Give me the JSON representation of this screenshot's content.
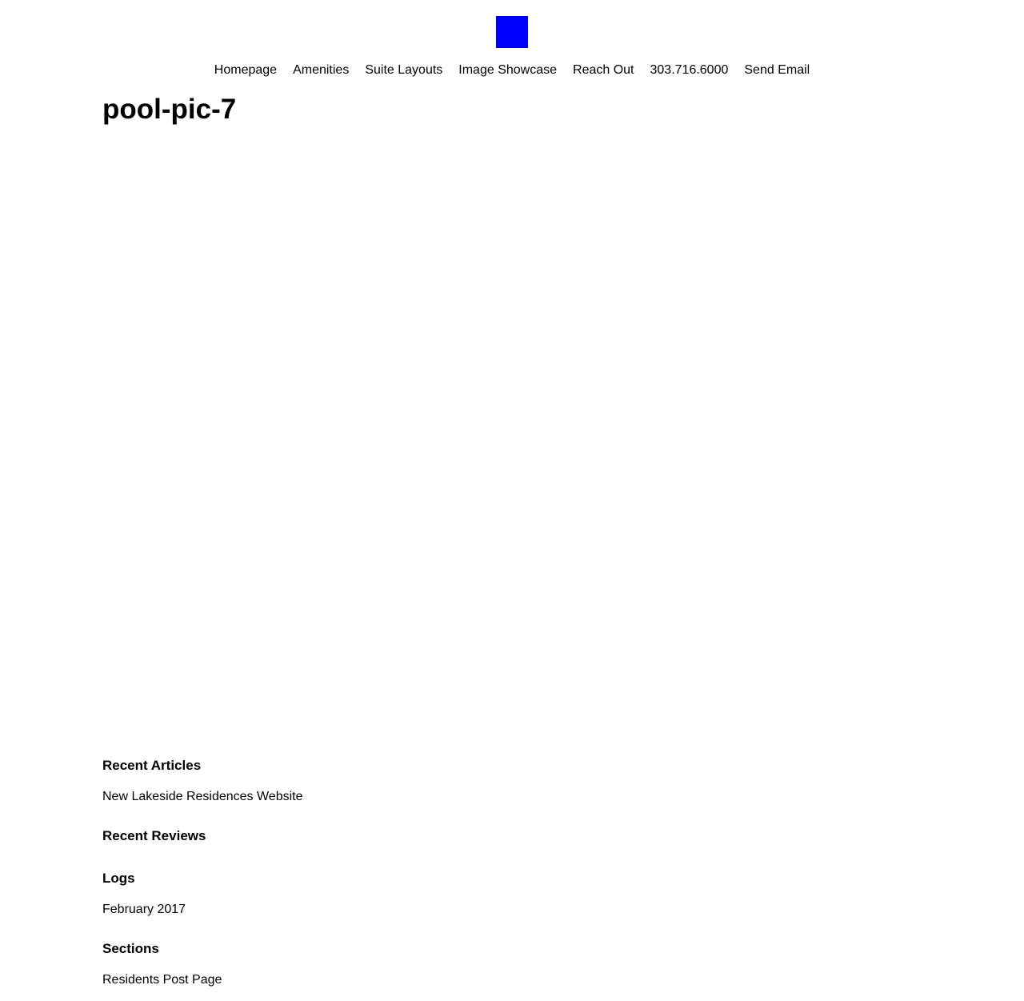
{
  "header": {
    "logo_color": "#0000ff",
    "nav": [
      {
        "label": "Homepage"
      },
      {
        "label": "Amenities"
      },
      {
        "label": "Suite Layouts"
      },
      {
        "label": "Image Showcase"
      },
      {
        "label": "Reach Out"
      },
      {
        "label": "303.716.6000"
      },
      {
        "label": "Send Email"
      }
    ]
  },
  "main": {
    "title": "pool-pic-7"
  },
  "sidebar": {
    "recent_articles": {
      "title": "Recent Articles",
      "items": [
        "New Lakeside Residences Website"
      ]
    },
    "recent_reviews": {
      "title": "Recent Reviews"
    },
    "logs": {
      "title": "Logs",
      "items": [
        "February 2017"
      ]
    },
    "sections": {
      "title": "Sections",
      "items": [
        "Residents Post Page"
      ]
    }
  }
}
